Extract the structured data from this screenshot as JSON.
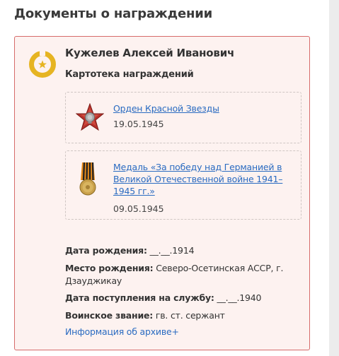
{
  "section": {
    "title": "Документы о награждении"
  },
  "person": {
    "name": "Кужелев Алексей Иванович",
    "card_title": "Картотека награждений"
  },
  "awards": [
    {
      "name": "Орден Красной Звезды",
      "date": "19.05.1945",
      "icon": "red-star-order-icon"
    },
    {
      "name": "Медаль «За победу над Германией в Великой Отечественной войне 1941–1945 гг.»",
      "date": "09.05.1945",
      "icon": "victory-medal-icon"
    }
  ],
  "details": {
    "birth_date_label": "Дата рождения:",
    "birth_date_value": "__.__.1914",
    "birth_place_label": "Место рождения:",
    "birth_place_value": "Северо-Осетинская АССР, г. Дзауджикау",
    "service_start_label": "Дата поступления на службу:",
    "service_start_value": "__.__.1940",
    "rank_label": "Воинское звание:",
    "rank_value": "гв. ст. сержант"
  },
  "archive_link": "Информация об архиве+",
  "colors": {
    "card_bg": "#fdf2f0",
    "card_border": "#d66b6b",
    "link": "#2a6bc1",
    "emblem": "#e6b422"
  }
}
